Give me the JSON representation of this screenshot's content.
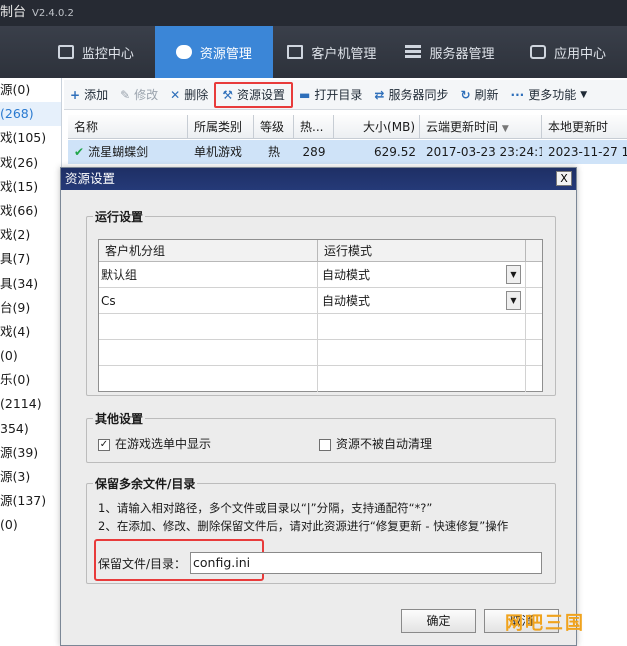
{
  "app": {
    "title": "制台",
    "version": "V2.4.0.2"
  },
  "nav": {
    "tabs": [
      "监控中心",
      "资源管理",
      "客户机管理",
      "服务器管理",
      "应用中心"
    ],
    "active": 1
  },
  "left_list": [
    "源(0)",
    "(268)",
    "戏(105)",
    "戏(26)",
    "戏(15)",
    "戏(66)",
    "戏(2)",
    "具(7)",
    "具(34)",
    "台(9)",
    "戏(4)",
    "(0)",
    "乐(0)",
    "(2114)",
    "354)",
    "源(39)",
    "源(3)",
    "源(137)",
    "(0)"
  ],
  "toolbar": {
    "add": "添加",
    "edit": "修改",
    "delete": "删除",
    "res_settings": "资源设置",
    "open_dir": "打开目录",
    "server_sync": "服务器同步",
    "refresh": "刷新",
    "more": "更多功能"
  },
  "table": {
    "headers": [
      "名称",
      "所属类别",
      "等级",
      "热...",
      "大小(MB)",
      "云端更新时间",
      "本地更新时"
    ],
    "row": [
      "流星蝴蝶剑",
      "单机游戏",
      "热",
      "289",
      "629.52",
      "2017-03-23 23:24:10",
      "2023-11-27 16"
    ]
  },
  "dialog": {
    "title": "资源设置",
    "close": "X",
    "run_settings": {
      "label": "运行设置",
      "headers": [
        "客户机分组",
        "运行模式"
      ],
      "rows": [
        [
          "默认组",
          "自动模式"
        ],
        [
          "Cs",
          "自动模式"
        ]
      ]
    },
    "other_settings": {
      "label": "其他设置",
      "show_in_menu": "在游戏选单中显示",
      "show_in_menu_checked": true,
      "no_auto_clean": "资源不被自动清理",
      "no_auto_clean_checked": false
    },
    "keep_files": {
      "label": "保留多余文件/目录",
      "hint1": "1、请输入相对路径，多个文件或目录以“|”分隔，支持通配符“*?”",
      "hint2": "2、在添加、修改、删除保留文件后，请对此资源进行“修复更新 - 快速修复”操作",
      "field_label": "保留文件/目录：",
      "field_value": "config.ini"
    },
    "ok": "确定",
    "cancel": "取消"
  },
  "watermark": "网吧三国",
  "colors": {
    "accent": "#3b86d7",
    "highlight": "#e83b3b",
    "dialog_title": "#1e2f65"
  }
}
